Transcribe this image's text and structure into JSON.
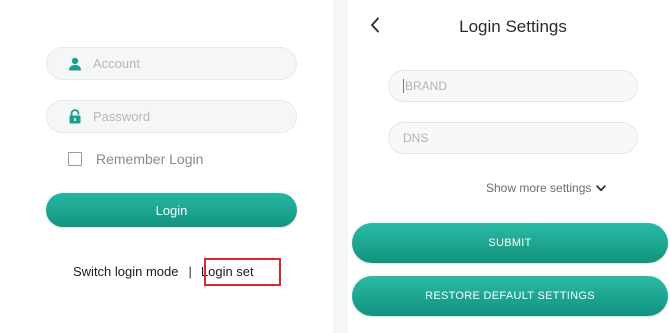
{
  "left_panel": {
    "account_placeholder": "Account",
    "password_placeholder": "Password",
    "remember_label": "Remember Login",
    "login_button": "Login",
    "switch_mode_link": "Switch login mode",
    "separator": "|",
    "login_set_link": "Login set"
  },
  "right_panel": {
    "title": "Login Settings",
    "brand_placeholder": "BRAND",
    "dns_placeholder": "DNS",
    "show_more_label": "Show more settings",
    "submit_button": "SUBMIT",
    "restore_button": "RESTORE DEFAULT SETTINGS"
  },
  "icons": {
    "account": "user-icon",
    "password": "lock-icon",
    "back": "chevron-left-icon",
    "show_more": "chevron-down-icon"
  },
  "colors": {
    "accent": "#17a28d",
    "highlight": "#d9272e"
  }
}
